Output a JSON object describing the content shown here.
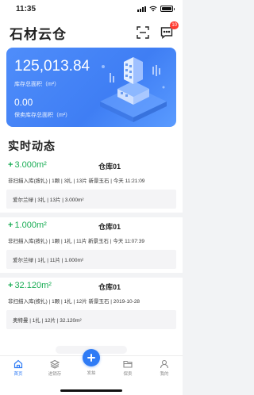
{
  "status_bar": {
    "time": "11:35"
  },
  "header": {
    "title": "石材云仓",
    "notification_count": "10"
  },
  "summary": {
    "total_area": "125,013.84",
    "total_area_label": "库存总面积（m²）",
    "reserved_area": "0.00",
    "reserved_area_label": "保卖库存总面积（m²）"
  },
  "section_title": "实时动态",
  "records": [
    {
      "area": "3.000m²",
      "warehouse": "仓库01",
      "detail": "非扫描入库(按扎) | 1颗 | 3扎 | 13片  新景玉石 | 今天  11:21:09",
      "sub": "爱尔兰绿 | 3扎 | 13片 | 3.000m²"
    },
    {
      "area": "1.000m²",
      "warehouse": "仓库01",
      "detail": "非扫描入库(按扎) | 1颗 | 1扎 | 11片  新景玉石 | 今天  11:07:39",
      "sub": "爱尔兰绿 | 1扎 | 11片 | 1.000m²"
    },
    {
      "area": "32.120m²",
      "warehouse": "仓库01",
      "detail": "非扫描入库(按扎) | 1颗 | 1扎 | 12片  新景玉石 | 2019-10-28",
      "sub": "奥特曼 | 1扎 | 12片 | 32.120m²"
    }
  ],
  "tabbar": {
    "home": "首页",
    "inventory": "进销存",
    "publish": "发拍",
    "reserve": "保卖",
    "mine": "我的"
  },
  "colors": {
    "accent": "#2f7bf5",
    "positive": "#1aad55",
    "badge": "#ff3b30"
  }
}
